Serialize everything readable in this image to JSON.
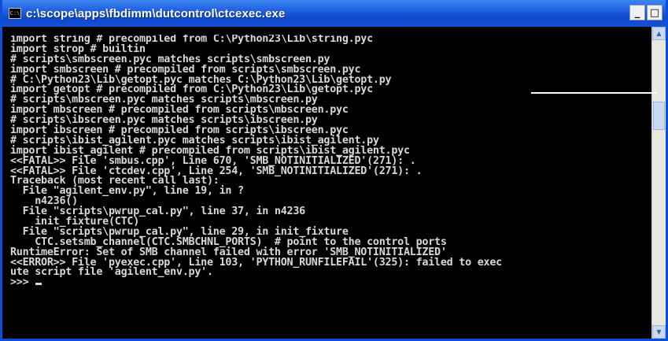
{
  "window": {
    "title": "c:\\scope\\apps\\fbdimm\\dutcontrol\\ctcexec.exe",
    "icon_label": "C:\\",
    "buttons": {
      "minimize": "_",
      "maximize": "□"
    }
  },
  "console": {
    "lines": [
      "import string # precompiled from C:\\Python23\\Lib\\string.pyc",
      "import strop # builtin",
      "# scripts\\smbscreen.pyc matches scripts\\smbscreen.py",
      "import smbscreen # precompiled from scripts\\smbscreen.pyc",
      "# C:\\Python23\\Lib\\getopt.pyc matches C:\\Python23\\Lib\\getopt.py",
      "import getopt # precompiled from C:\\Python23\\Lib\\getopt.pyc",
      "# scripts\\mbscreen.pyc matches scripts\\mbscreen.py",
      "import mbscreen # precompiled from scripts\\mbscreen.pyc",
      "# scripts\\ibscreen.pyc matches scripts\\ibscreen.py",
      "import ibscreen # precompiled from scripts\\ibscreen.pyc",
      "# scripts\\ibist_agilent.pyc matches scripts\\ibist_agilent.py",
      "import ibist_agilent # precompiled from scripts\\ibist_agilent.pyc",
      "<<FATAL>> File 'smbus.cpp', Line 670, 'SMB_NOTINITIALIZED'(271): .",
      "<<FATAL>> File 'ctcdev.cpp', Line 254, 'SMB_NOTINITIALIZED'(271): .",
      "Traceback (most recent call last):",
      "  File \"agilent_env.py\", line 19, in ?",
      "    n4236()",
      "  File \"scripts\\pwrup_cal.py\", line 37, in n4236",
      "    init_fixture(CTC)",
      "  File \"scripts\\pwrup_cal.py\", line 29, in init_fixture",
      "    CTC.setsmb_channel(CTC.SMBCHNL_PORTS)  # point to the control ports",
      "RuntimeError: Set of SMB channel failed with error 'SMB_NOTINITIALIZED'",
      "<<ERROR>> File 'pyexec.cpp', Line 103, 'PYTHON_RUNFILEFAIL'(325): failed to exec",
      "ute script file 'agilent_env.py'."
    ],
    "prompt": ">>> "
  },
  "colors": {
    "titlebar": "#1f5fe0",
    "console_bg": "#000000",
    "console_text": "#d8d8d8",
    "annotation_line": "#ffffff"
  }
}
